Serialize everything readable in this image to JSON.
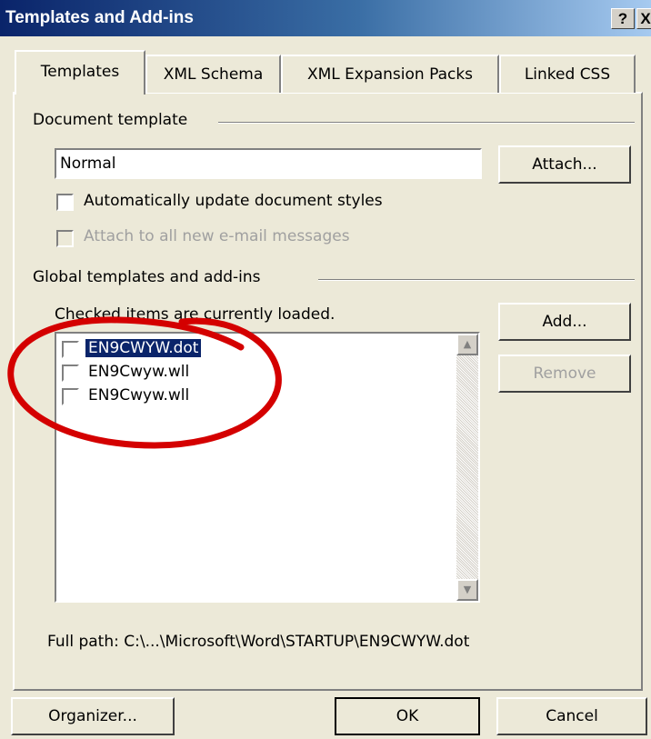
{
  "window": {
    "title": "Templates and Add-ins",
    "help_label": "?",
    "close_label": "X"
  },
  "tabs": [
    {
      "label": "Templates",
      "active": true
    },
    {
      "label": "XML Schema",
      "active": false
    },
    {
      "label": "XML Expansion Packs",
      "active": false
    },
    {
      "label": "Linked CSS",
      "active": false
    }
  ],
  "document_template": {
    "group_label": "Document template",
    "value": "Normal",
    "attach_label": "Attach...",
    "auto_update_label": "Automatically update document styles",
    "auto_update_checked": false,
    "attach_all_label": "Attach to all new e-mail messages",
    "attach_all_checked": false,
    "attach_all_enabled": false
  },
  "global_templates": {
    "group_label": "Global templates and add-ins",
    "hint": "Checked items are currently loaded.",
    "items": [
      {
        "label": "EN9CWYW.dot",
        "checked": false,
        "selected": true
      },
      {
        "label": "EN9Cwyw.wll",
        "checked": false,
        "selected": false
      },
      {
        "label": "EN9Cwyw.wll",
        "checked": false,
        "selected": false
      }
    ],
    "add_label": "Add...",
    "remove_label": "Remove",
    "remove_enabled": false,
    "full_path_text": "Full path:   C:\\...\\Microsoft\\Word\\STARTUP\\EN9CWYW.dot"
  },
  "footer": {
    "organizer_label": "Organizer...",
    "ok_label": "OK",
    "cancel_label": "Cancel"
  },
  "colors": {
    "dialog_background": "#ece9d8",
    "titlebar_start": "#0a246a",
    "titlebar_end": "#a6caf0",
    "selection": "#0a246a",
    "annotation_circle": "#d40000"
  },
  "icons": [
    "scroll-up-arrow-icon",
    "scroll-down-arrow-icon"
  ]
}
